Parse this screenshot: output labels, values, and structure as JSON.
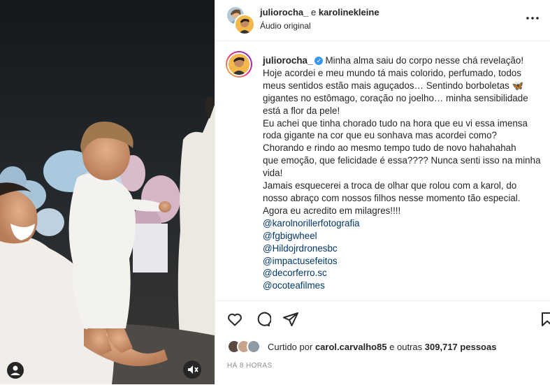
{
  "header": {
    "user1": "juliorocha_",
    "connector": "e",
    "user2": "karolinekleine",
    "audio": "Áudio original",
    "more_icon": "more-horizontal-icon"
  },
  "caption": {
    "username": "juliorocha_",
    "lines": [
      "Minha alma saiu do corpo nesse chá revelação!",
      "Hoje acordei e meu mundo tá mais colorido, perfumado, todos",
      "meus sentidos estão mais aguçados… Sentindo borboletas 🦋",
      "gigantes no estômago, coração no joelho… minha sensibilidade",
      "está a flor da pele!",
      "Eu achei que tinha chorado tudo na hora que eu vi essa imensa",
      "roda gigante na cor que eu sonhava mas acordei como?",
      "Chorando e rindo ao mesmo tempo tudo de novo hahahahah",
      "que emoção, que felicidade é essa???? Nunca senti isso na minha",
      "vida!",
      "Jamais esquecerei a troca de olhar que rolou com a karol, do",
      "nosso abraço com nossos filhos nesse momento tão especial.",
      "Agora eu acredito em milagres!!!!"
    ],
    "mentions": [
      "@karolnorillerfotografia",
      "@fgbigwheel",
      "@Hildojrdronesbc",
      "@impactusefeitos",
      "@decorferro.sc",
      "@ocoteafilmes"
    ]
  },
  "actions": {
    "like_icon": "heart-icon",
    "comment_icon": "comment-icon",
    "share_icon": "share-icon",
    "save_icon": "bookmark-icon"
  },
  "likes": {
    "prefix": "Curtido por",
    "user": "carol.carvalho85",
    "middle": "e outras",
    "count": "309,717",
    "suffix": "pessoas"
  },
  "timestamp": "HÁ 8 HORAS",
  "colors": {
    "verified": "#3897f0",
    "mention": "#00376b",
    "muted": "#8e8e8e"
  }
}
